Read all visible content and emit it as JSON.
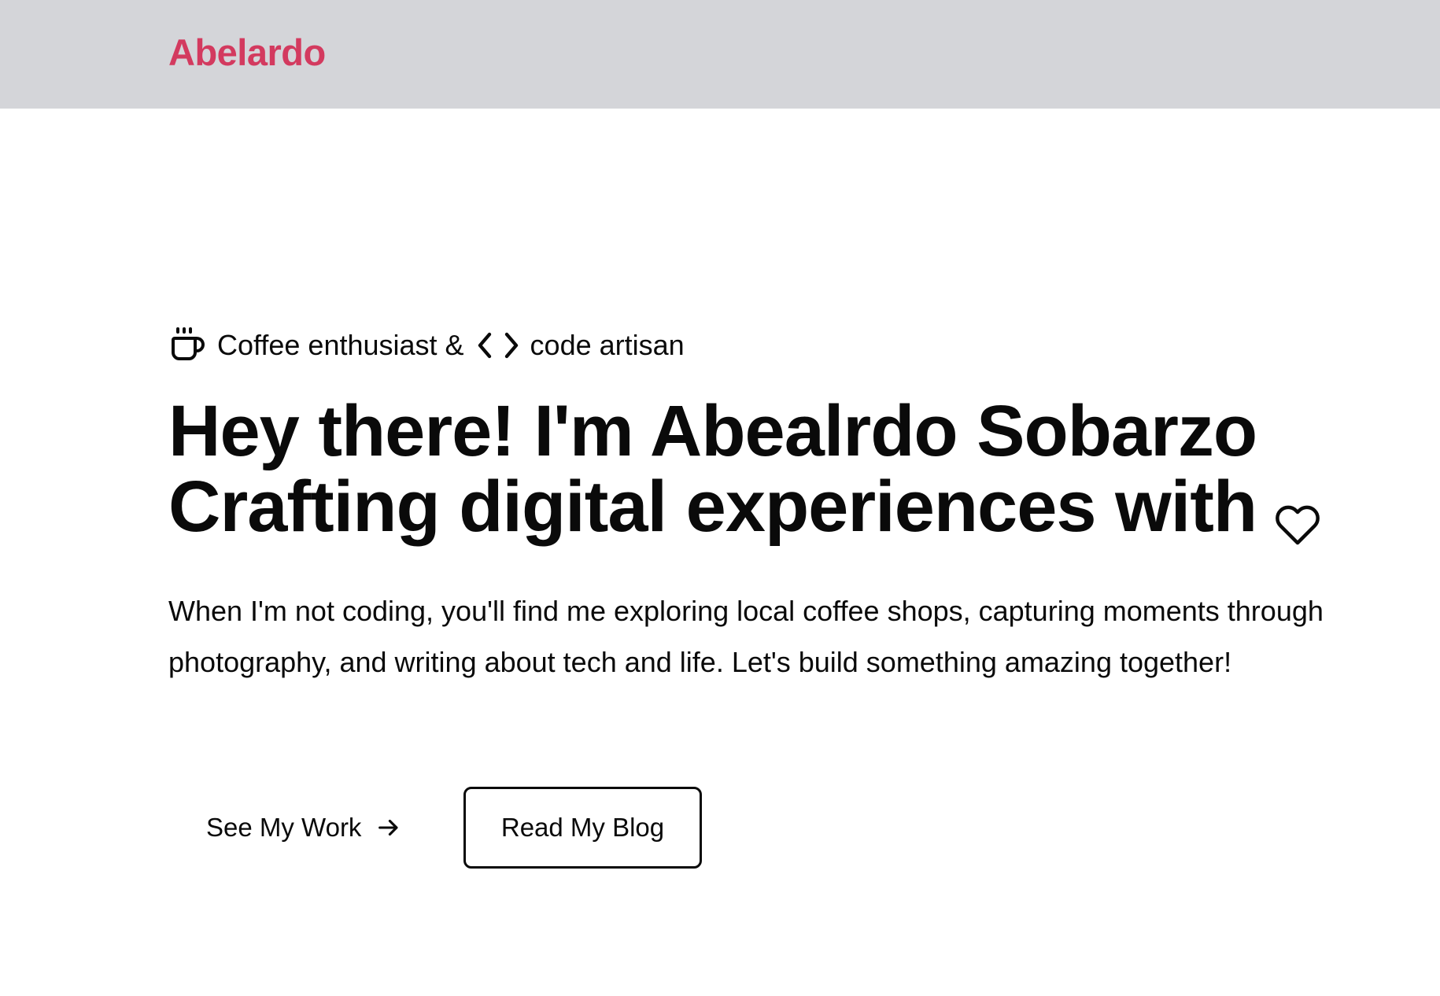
{
  "header": {
    "logo_text": "Abelardo"
  },
  "hero": {
    "tagline_before": "Coffee enthusiast &",
    "tagline_after": "code artisan",
    "headline_line1": "Hey there! I'm Abealrdo Sobarzo",
    "headline_line2": "Crafting digital experiences with",
    "intro": "When I'm not coding, you'll find me exploring local coffee shops, capturing moments through photography, and writing about tech and life. Let's build something amazing together!",
    "primary_cta_label": "See My Work",
    "secondary_cta_label": "Read My Blog"
  },
  "icons": {
    "tagline_start": "coffee-cup-icon",
    "tagline_middle": "code-brackets-icon",
    "headline_end": "heart-icon",
    "primary_cta": "arrow-right-icon"
  },
  "colors": {
    "brand": "#d33a5f",
    "header_background": "#d4d5d9",
    "text": "#0a0a0a"
  }
}
